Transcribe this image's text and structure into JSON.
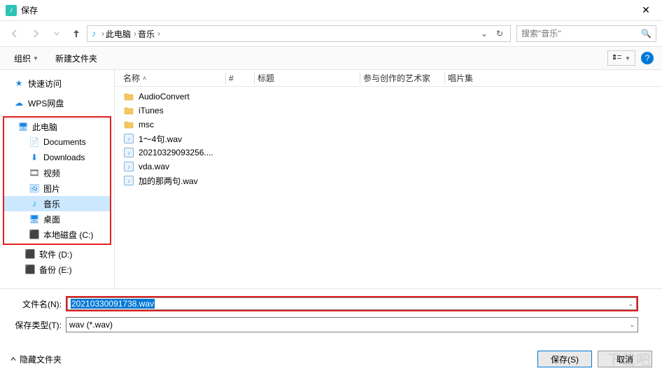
{
  "window": {
    "title": "保存"
  },
  "nav": {
    "crumbs": [
      "此电脑",
      "音乐"
    ],
    "search_placeholder": "搜索\"音乐\""
  },
  "toolbar": {
    "organize": "组织",
    "new_folder": "新建文件夹"
  },
  "sidebar": {
    "quick_access": "快速访问",
    "wps": "WPS网盘",
    "this_pc": "此电脑",
    "documents": "Documents",
    "downloads": "Downloads",
    "videos": "视频",
    "pictures": "图片",
    "music": "音乐",
    "desktop": "桌面",
    "local_c": "本地磁盘 (C:)",
    "soft_d": "软件 (D:)",
    "backup_e": "备份 (E:)"
  },
  "columns": {
    "name": "名称",
    "num": "#",
    "title": "标题",
    "artist": "参与创作的艺术家",
    "album": "唱片集"
  },
  "files": [
    {
      "type": "folder",
      "name": "AudioConvert"
    },
    {
      "type": "folder",
      "name": "iTunes"
    },
    {
      "type": "folder",
      "name": "msc"
    },
    {
      "type": "wav",
      "name": "1～4句.wav"
    },
    {
      "type": "wav",
      "name": "20210329093256...."
    },
    {
      "type": "wav",
      "name": "vda.wav"
    },
    {
      "type": "wav",
      "name": "加的那两句.wav"
    }
  ],
  "form": {
    "filename_label": "文件名(N):",
    "filename_value": "20210330091738.wav",
    "filetype_label": "保存类型(T):",
    "filetype_value": "wav (*.wav)"
  },
  "footer": {
    "hide_folders": "隐藏文件夹",
    "save": "保存(S)",
    "cancel": "取消"
  }
}
